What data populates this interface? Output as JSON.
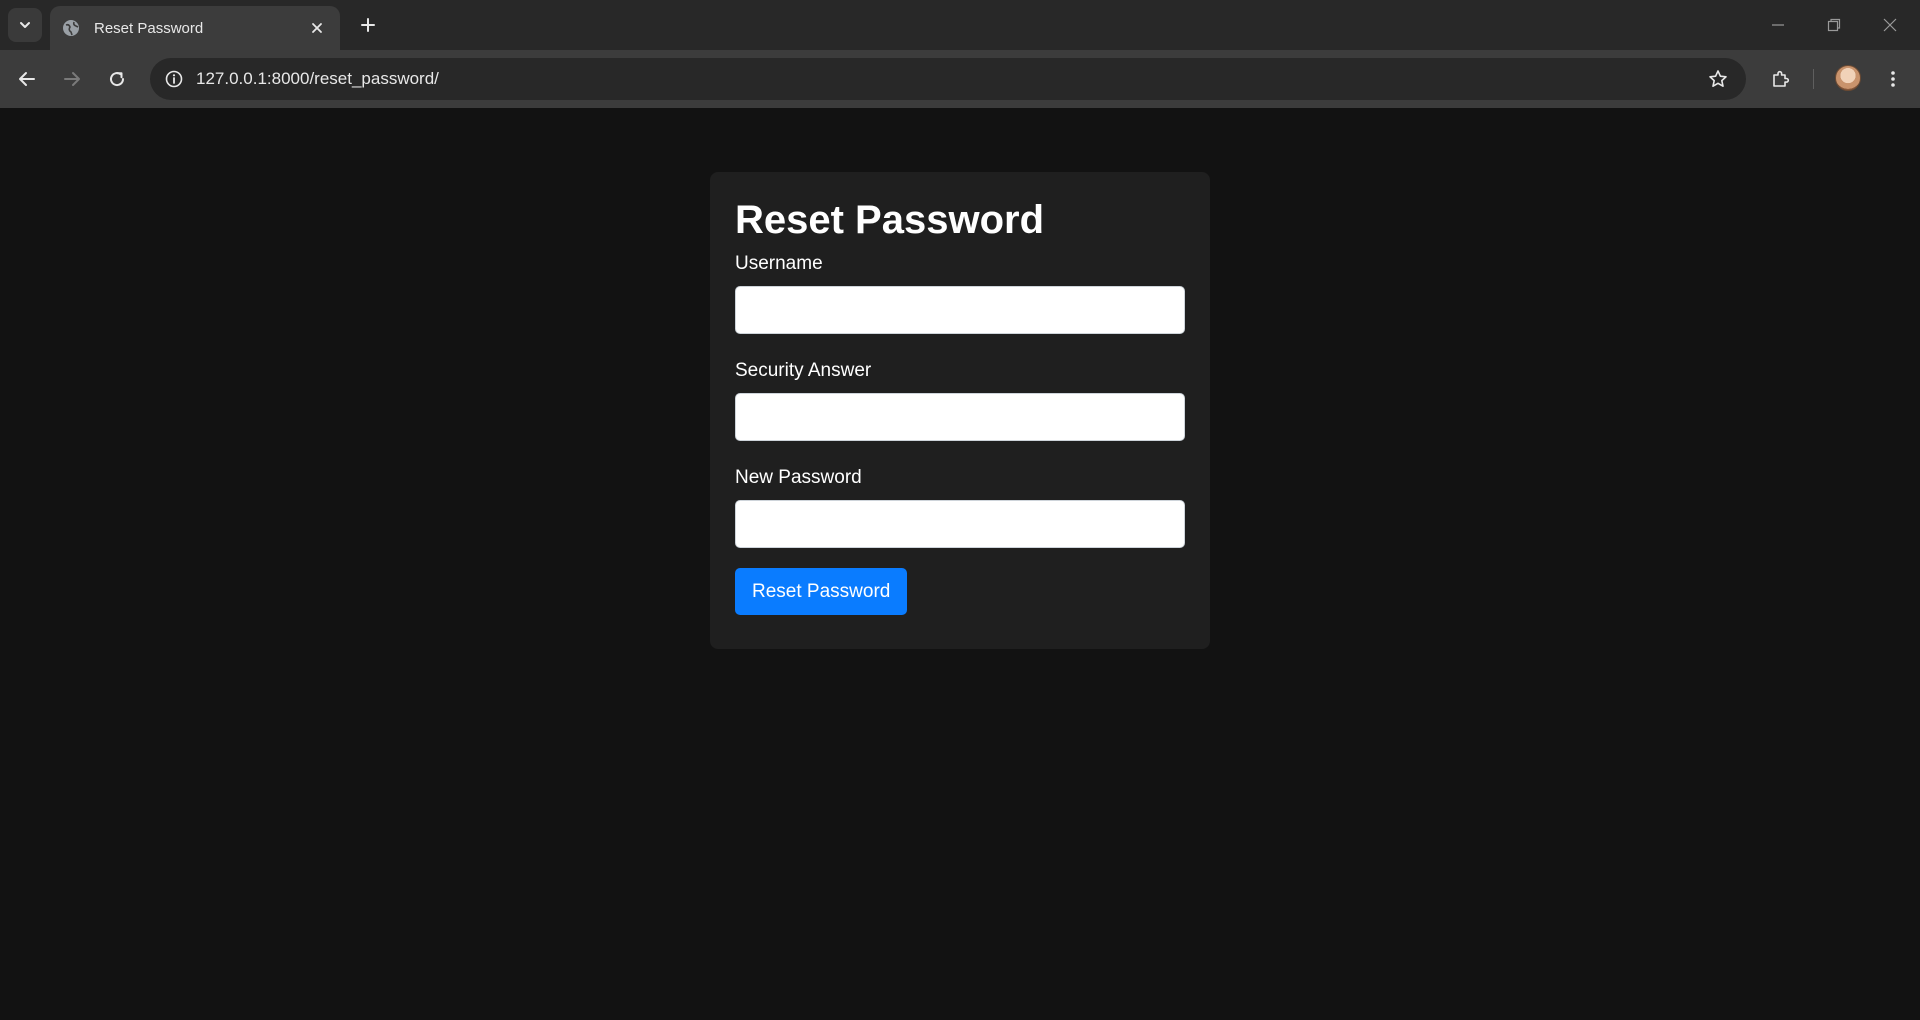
{
  "browser": {
    "tab": {
      "title": "Reset Password"
    },
    "url": "127.0.0.1:8000/reset_password/"
  },
  "form": {
    "title": "Reset Password",
    "fields": [
      {
        "label": "Username",
        "value": "",
        "placeholder": ""
      },
      {
        "label": "Security Answer",
        "value": "",
        "placeholder": ""
      },
      {
        "label": "New Password",
        "value": "",
        "placeholder": ""
      }
    ],
    "submit_label": "Reset Password",
    "submit_color": "#0a7cff"
  },
  "icons": {
    "tab_search": "chevron-down-icon",
    "tab_favicon": "globe-icon",
    "tab_close": "close-icon",
    "new_tab": "plus-icon",
    "back": "arrow-left-icon",
    "forward": "arrow-right-icon",
    "reload": "reload-icon",
    "site_info": "info-icon",
    "bookmark": "star-icon",
    "extensions": "puzzle-icon",
    "menu": "kebab-menu-icon",
    "minimize": "minimize-icon",
    "restore": "restore-icon",
    "close_window": "close-window-icon"
  }
}
